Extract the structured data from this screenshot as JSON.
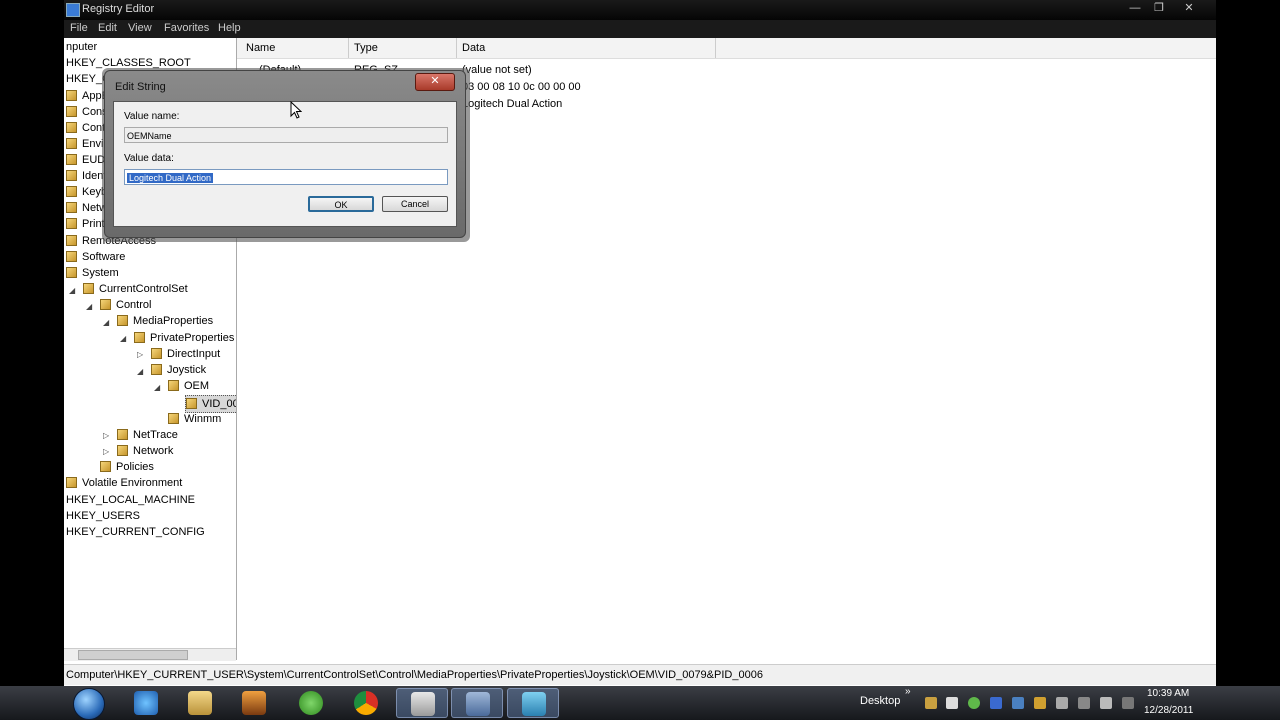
{
  "window": {
    "title": "Registry Editor",
    "controls": {
      "minimize": "—",
      "maximize": "❐",
      "close": "✕"
    }
  },
  "menu": [
    "File",
    "Edit",
    "View",
    "Favorites",
    "Help"
  ],
  "tree": {
    "items": [
      {
        "label": "nputer"
      },
      {
        "label": "HKEY_CLASSES_ROOT"
      },
      {
        "label": "HKEY_C"
      },
      {
        "label": "AppEv"
      },
      {
        "label": "Conso"
      },
      {
        "label": "Contr"
      },
      {
        "label": "Enviro"
      },
      {
        "label": "EUDC"
      },
      {
        "label": "Identi"
      },
      {
        "label": "Keybo"
      },
      {
        "label": "Netwo"
      },
      {
        "label": "Printe"
      },
      {
        "label": "RemoteAccess"
      },
      {
        "label": "Software"
      },
      {
        "label": "System"
      },
      {
        "label": "CurrentControlSet"
      },
      {
        "label": "Control"
      },
      {
        "label": "MediaProperties"
      },
      {
        "label": "PrivateProperties"
      },
      {
        "label": "DirectInput"
      },
      {
        "label": "Joystick"
      },
      {
        "label": "OEM"
      },
      {
        "label": "VID_00"
      },
      {
        "label": "Winmm"
      },
      {
        "label": "NetTrace"
      },
      {
        "label": "Network"
      },
      {
        "label": "Policies"
      },
      {
        "label": "Volatile Environment"
      },
      {
        "label": "HKEY_LOCAL_MACHINE"
      },
      {
        "label": "HKEY_USERS"
      },
      {
        "label": "HKEY_CURRENT_CONFIG"
      }
    ]
  },
  "list": {
    "columns": [
      "Name",
      "Type",
      "Data"
    ],
    "rows": [
      {
        "name": "(Default)",
        "type": "REG_SZ",
        "data": "(value not set)"
      },
      {
        "name": "",
        "type": "",
        "data": "03 00 08 10 0c 00 00 00"
      },
      {
        "name": "",
        "type": "",
        "data": "Logitech Dual Action"
      }
    ]
  },
  "status": "Computer\\HKEY_CURRENT_USER\\System\\CurrentControlSet\\Control\\MediaProperties\\PrivateProperties\\Joystick\\OEM\\VID_0079&PID_0006",
  "dialog": {
    "title": "Edit String",
    "close": "✕",
    "value_name_label": "Value name:",
    "value_name": "OEMName",
    "value_data_label": "Value data:",
    "value_data": "Logitech Dual Action",
    "ok": "OK",
    "cancel": "Cancel"
  },
  "taskbar": {
    "desktop_label": "Desktop",
    "time": "10:39 AM",
    "date": "12/28/2011"
  }
}
